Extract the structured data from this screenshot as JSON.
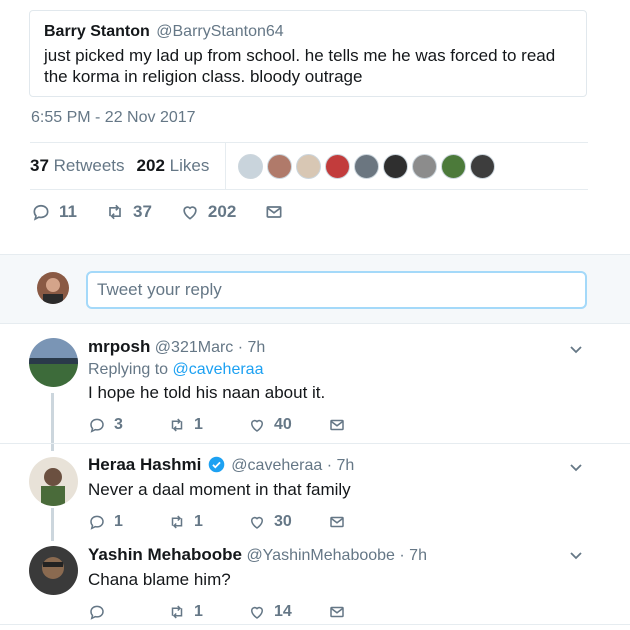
{
  "quoted": {
    "name": "Barry Stanton",
    "handle": "@BarryStanton64",
    "text": "just picked my lad up from school. he tells me he was forced to read the korma in religion class. bloody outrage"
  },
  "timestamp": "6:55 PM - 22 Nov 2017",
  "stats": {
    "retweets_count": "37",
    "retweets_label": "Retweets",
    "likes_count": "202",
    "likes_label": "Likes"
  },
  "likers_colors": [
    "#c9d4dc",
    "#b07a6a",
    "#d8c7b4",
    "#c23c3c",
    "#6b7680",
    "#2f2f2f",
    "#8c8c8c",
    "#4c7a3a",
    "#3d3d3d"
  ],
  "actions": {
    "replies": "11",
    "retweets": "37",
    "likes": "202"
  },
  "reply_box": {
    "placeholder": "Tweet your reply"
  },
  "colors": {
    "accent": "#1da1f2",
    "muted": "#657786",
    "border": "#e6ecf0"
  },
  "replies": [
    {
      "name": "mrposh",
      "handle": "@321Marc",
      "time": "7h",
      "verified": false,
      "replying_prefix": "Replying to",
      "replying_to": "@caveheraa",
      "text": "I hope he told his naan about it.",
      "replies": "3",
      "retweets": "1",
      "likes": "40",
      "avatar_color": "#3d6b3a"
    },
    {
      "name": "Heraa Hashmi",
      "handle": "@caveheraa",
      "time": "7h",
      "verified": true,
      "text": "Never a daal moment in that family",
      "replies": "1",
      "retweets": "1",
      "likes": "30",
      "avatar_color": "#5a6b4a"
    },
    {
      "name": "Yashin Mehaboobe",
      "handle": "@YashinMehaboobe",
      "time": "7h",
      "verified": false,
      "text": "Chana blame him?",
      "replies": "",
      "retweets": "1",
      "likes": "14",
      "avatar_color": "#3a3a3a"
    }
  ]
}
